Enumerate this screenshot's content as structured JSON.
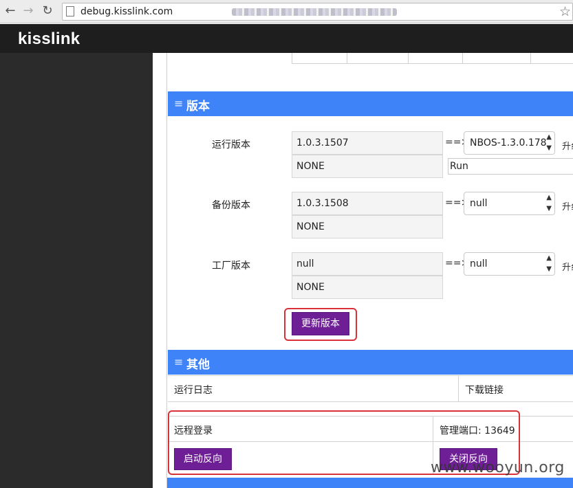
{
  "browser": {
    "url": "debug.kisslink.com"
  },
  "app": {
    "logo": "kisslink"
  },
  "version_section": {
    "title": "版本",
    "rows": [
      {
        "label": "运行版本",
        "current": "1.0.3.1507",
        "status": "NONE",
        "arrow": "==>",
        "select": "NBOS-1.3.0.178",
        "edge": "升纟"
      },
      {
        "label": "备份版本",
        "current": "1.0.3.1508",
        "status": "NONE",
        "arrow": "==>",
        "select": "null",
        "edge": "升纟"
      },
      {
        "label": "工厂版本",
        "current": "null",
        "status": "NONE",
        "arrow": "==>",
        "select": "null",
        "edge": "升纟"
      }
    ],
    "run_input": "Run",
    "update_button": "更新版本"
  },
  "other_section": {
    "title": "其他",
    "log_label": "运行日志",
    "download_label": "下载链接",
    "remote_login_label": "远程登录",
    "mgmt_port_label": "管理端口: 13649",
    "start_reverse_button": "启动反向",
    "close_reverse_button": "关闭反向"
  },
  "watermark": "www.wooyun.org",
  "colors": {
    "section_bar": "#3f83f8",
    "button": "#6f1f95",
    "highlight_frame": "#d9313a",
    "header": "#1e1e1e",
    "sidebar": "#2b2b2b"
  }
}
